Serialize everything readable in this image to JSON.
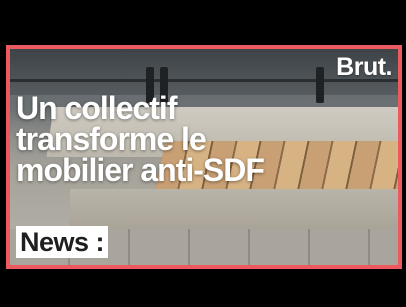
{
  "thumbnail": {
    "brand": "Brut.",
    "headline_lines": [
      "Un collectif",
      "transforme le",
      "mobilier anti-SDF"
    ],
    "tag": "News :"
  },
  "colors": {
    "border": "#ec5a5f",
    "tag_background": "#ffffff",
    "text": "#ffffff"
  }
}
